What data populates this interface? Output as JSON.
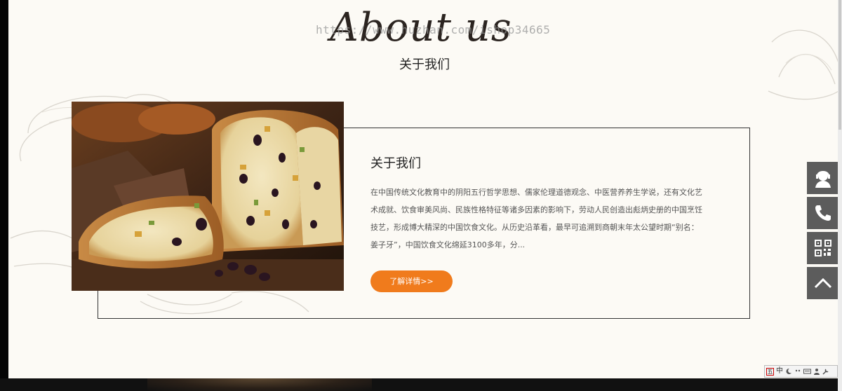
{
  "header": {
    "script_title": "About us",
    "watermark": "https://www.huzhan.com/ishop34665",
    "title": "关于我们"
  },
  "about": {
    "heading": "关于我们",
    "body": "在中国传统文化教育中的阴阳五行哲学思想、儒家伦理道德观念、中医营养养生学说，还有文化艺术成就、饮食审美风尚、民族性格特征等诸多因素的影响下，劳动人民创造出彪炳史册的中国烹饪技艺，形成博大精深的中国饮食文化。从历史沿革看，最早可追溯到商朝末年太公望时期“别名：姜子牙”，中国饮食文化绵延3100多年，分...",
    "more_label": "了解详情>>",
    "photo": "bread-with-raisins-photo"
  },
  "side_tools": [
    {
      "icon": "customer-service-icon"
    },
    {
      "icon": "phone-icon"
    },
    {
      "icon": "qr-code-icon"
    },
    {
      "icon": "back-to-top-icon"
    }
  ],
  "ime_toolbar": {
    "logo": "五",
    "lang": "中"
  },
  "colors": {
    "background": "#fcfaf5",
    "accent": "#f07b1c",
    "tool_bg": "#5c5c5c"
  }
}
